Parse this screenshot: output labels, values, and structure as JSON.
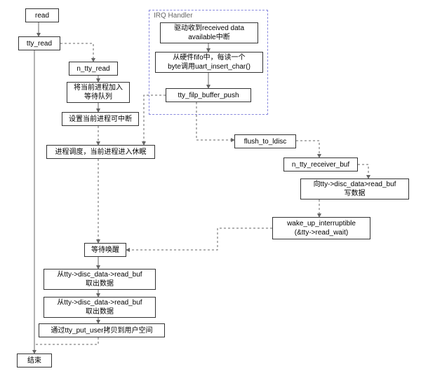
{
  "nodes": {
    "read": "read",
    "tty_read": "tty_read",
    "n_tty_read": "n_tty_read",
    "enqueue": "将当前进程加入\n等待队列",
    "set_interruptible": "设置当前进程可中断",
    "schedule_sleep": "进程调度，当前进程进入休眠",
    "wait_wake": "等待唤醒",
    "copy_buf1": "从tty->disc_data->read_buf\n取出数据",
    "copy_buf2": "从tty->disc_data->read_buf\n取出数据",
    "put_user": "通过tty_put_user拷贝到用户空间",
    "end": "结束",
    "irq_label": "IRQ Handler",
    "irq_recv": "驱动收到received data\navailable中断",
    "irq_fifo": "从硬件fifo中，每读一个\nbyte调用uart_insert_char()",
    "irq_push": "tty_filp_buffer_push",
    "flush": "flush_to_ldisc",
    "n_tty_recv_buf": "n_tty_receiver_buf",
    "write_buf": "向tty->disc_data>read_buf\n写数据",
    "wake": "wake_up_interruptible\n(&tty->read_wait)"
  }
}
